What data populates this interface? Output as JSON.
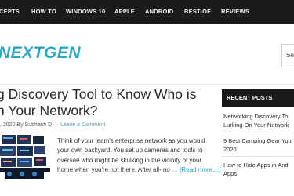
{
  "topnav": {
    "items": [
      "CEPTS",
      "HOW TO",
      "WINDOWS 10",
      "APPLE",
      "ANDROID",
      "BEST-OF",
      "REVIEWS"
    ]
  },
  "header": {
    "logo_text": "NEXTGEN",
    "search_placeholder": "Sea"
  },
  "post": {
    "title_lines": [
      "g Discovery Tool to Know Who is",
      "n Your Network?"
    ],
    "meta_date": ", 2020 By Subhash D",
    "meta_sep": "—",
    "meta_comment": "Leave a Comment",
    "excerpt_lines": [
      "Think of your team's enterprise network as you would",
      "your own backyard. You set up cameras and tools to",
      "oversee who might be skulking in the vicinity of your",
      "home when you're not there. After all- no "
    ],
    "read_more": "… [Read more…]"
  },
  "sidebar": {
    "heading": "RECENT POSTS",
    "links": [
      [
        "Networking Discovery To",
        "Lurking On Your Network"
      ],
      [
        "9 Best Camping Gear You",
        "2020"
      ],
      [
        "How to Hide Apps in And",
        "Apps"
      ]
    ]
  },
  "colors": {
    "accent": "#2aa7c4",
    "nav_bg": "#1b1b1b",
    "text": "#2a2a2a"
  }
}
